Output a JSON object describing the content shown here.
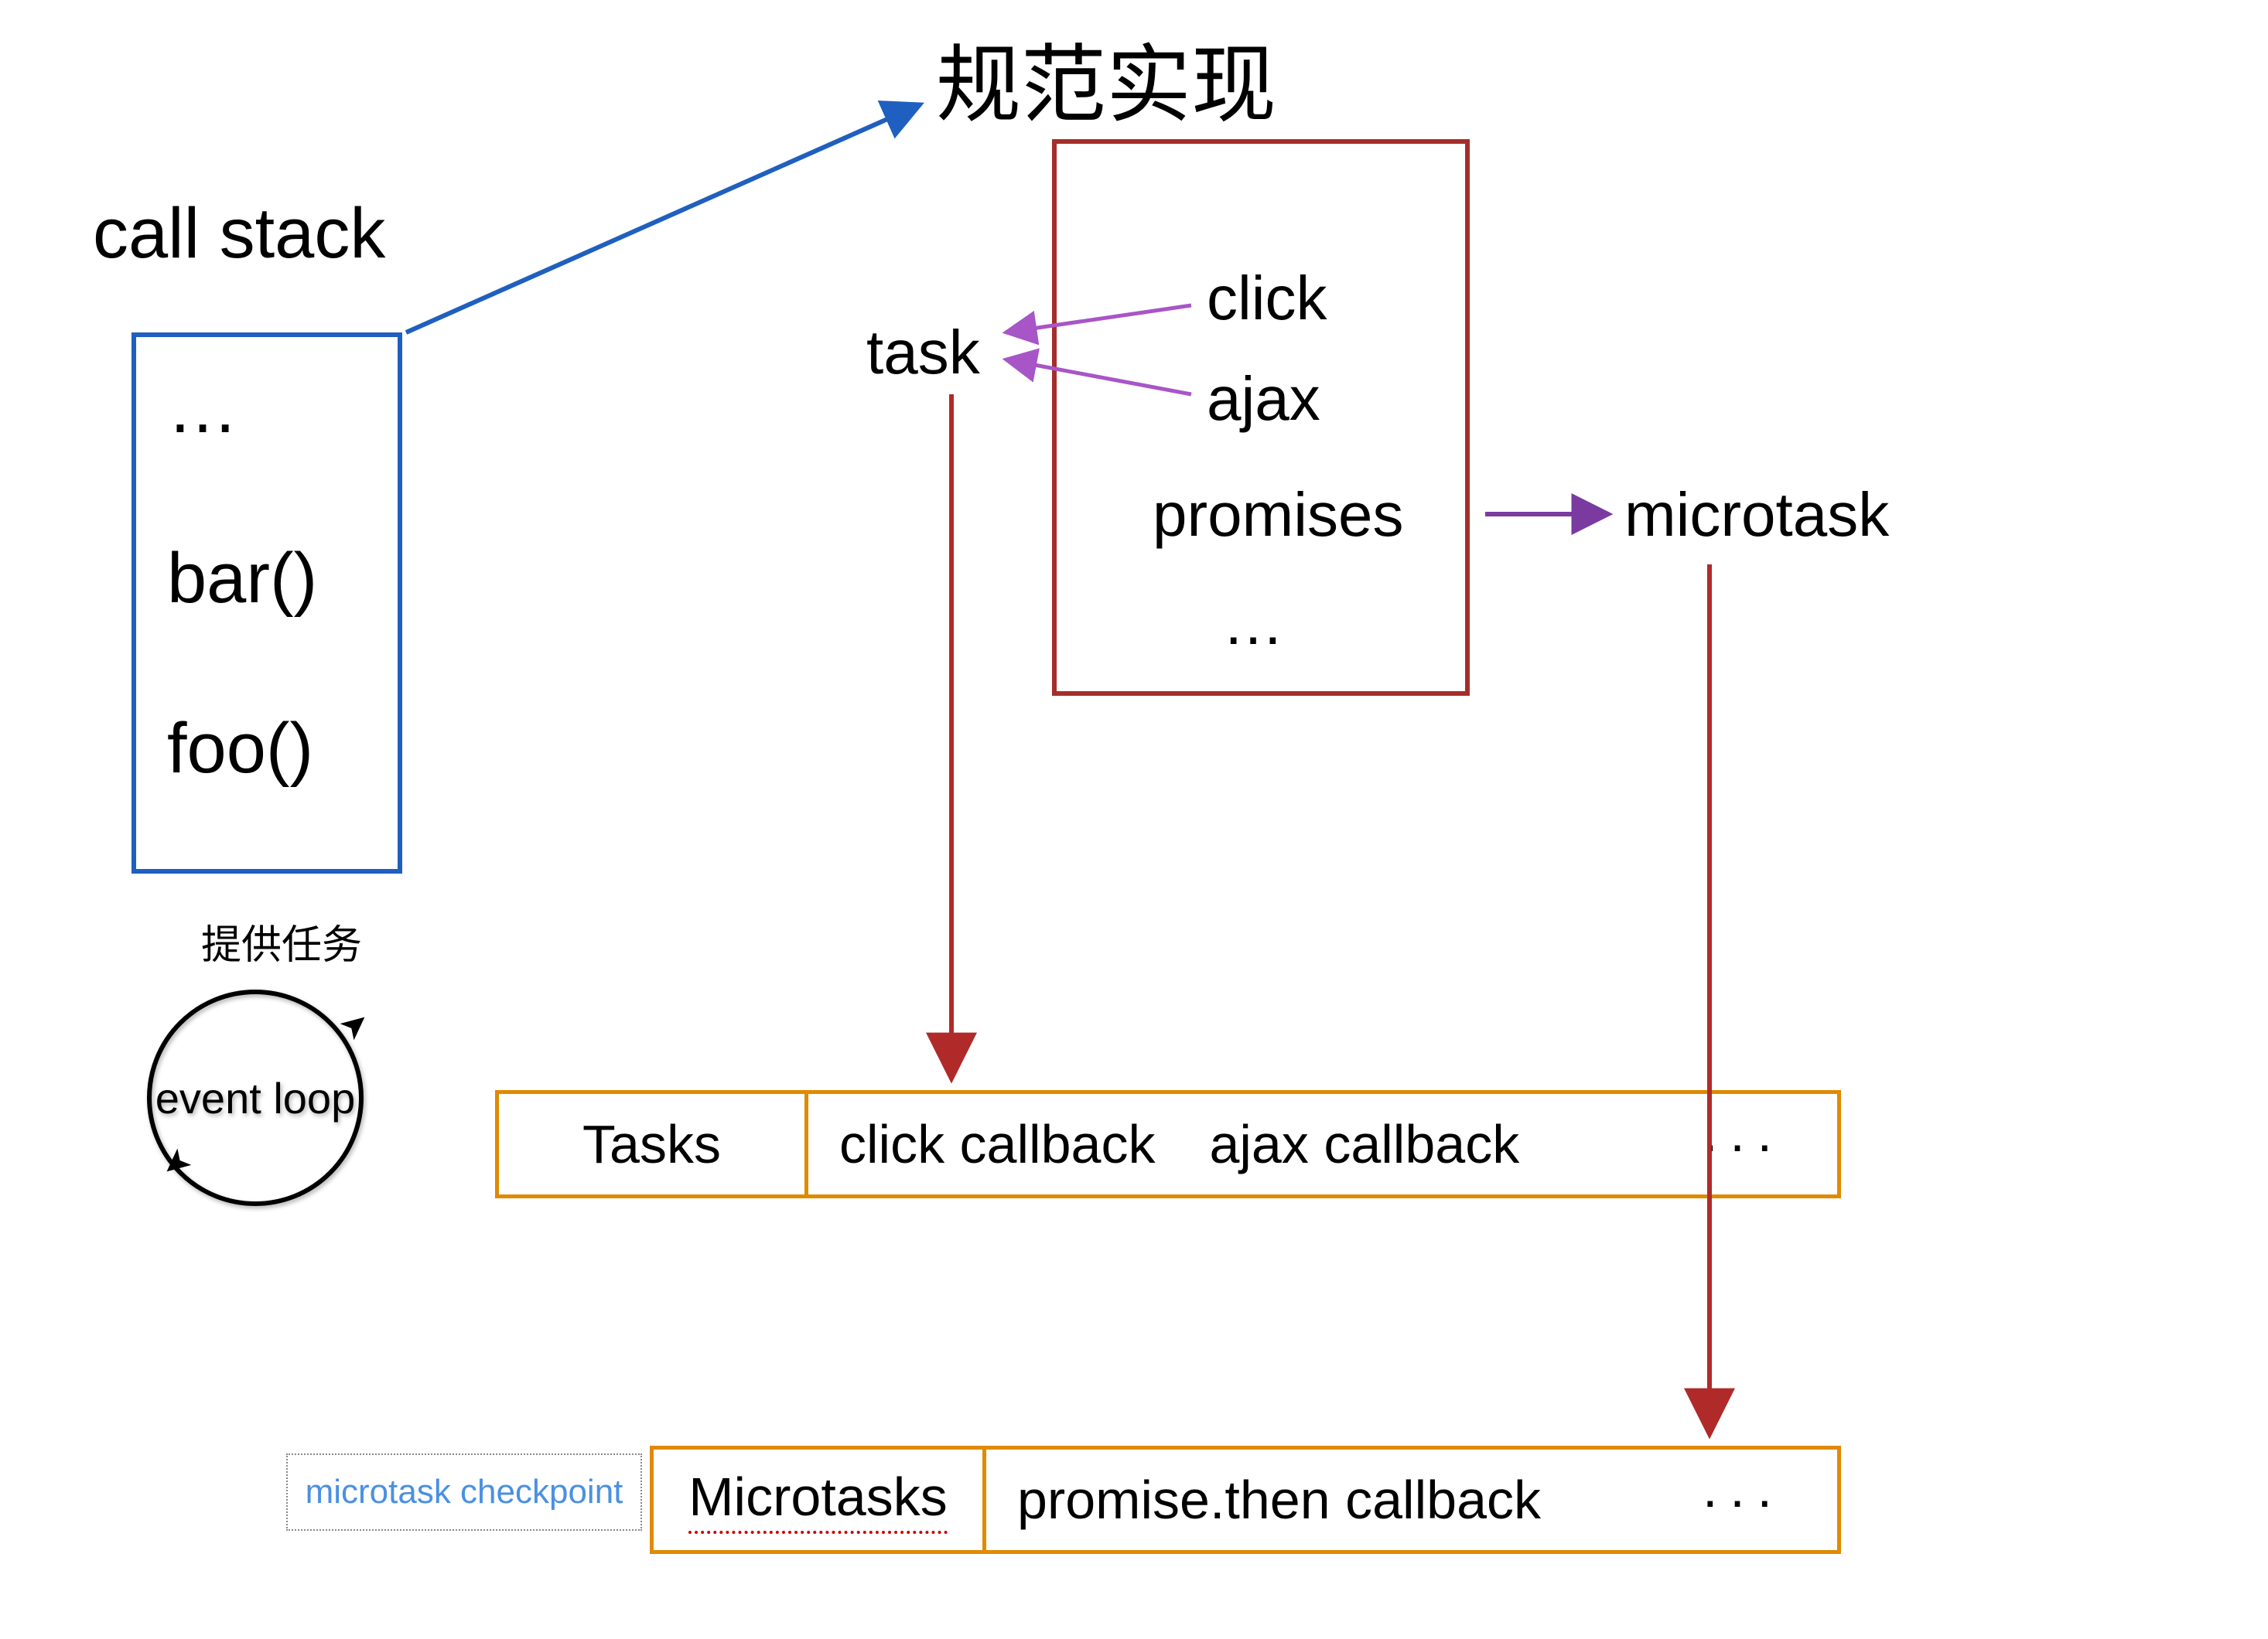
{
  "titles": {
    "call_stack": "call stack",
    "spec": "规范实现",
    "task": "task",
    "microtask": "microtask",
    "provide": "提供任务",
    "event_loop": "event loop",
    "checkpoint": "microtask checkpoint"
  },
  "call_stack": {
    "items": [
      "…",
      "bar()",
      "foo()"
    ]
  },
  "spec_box": {
    "items": [
      "click",
      "ajax",
      "promises",
      "…"
    ]
  },
  "tasks_queue": {
    "header": "Tasks",
    "cells": [
      "click callback",
      "ajax callback",
      "···"
    ]
  },
  "microtasks_queue": {
    "header": "Microtasks",
    "cells": [
      "promise.then callback",
      "···"
    ]
  },
  "colors": {
    "blue": "#1f5fbf",
    "red": "#a52e2a",
    "orange": "#e08a00",
    "purple": "#a855c7",
    "darkpurple": "#7a3aa0",
    "darkred": "#b02a2a",
    "lightblue": "#4a90e2"
  }
}
